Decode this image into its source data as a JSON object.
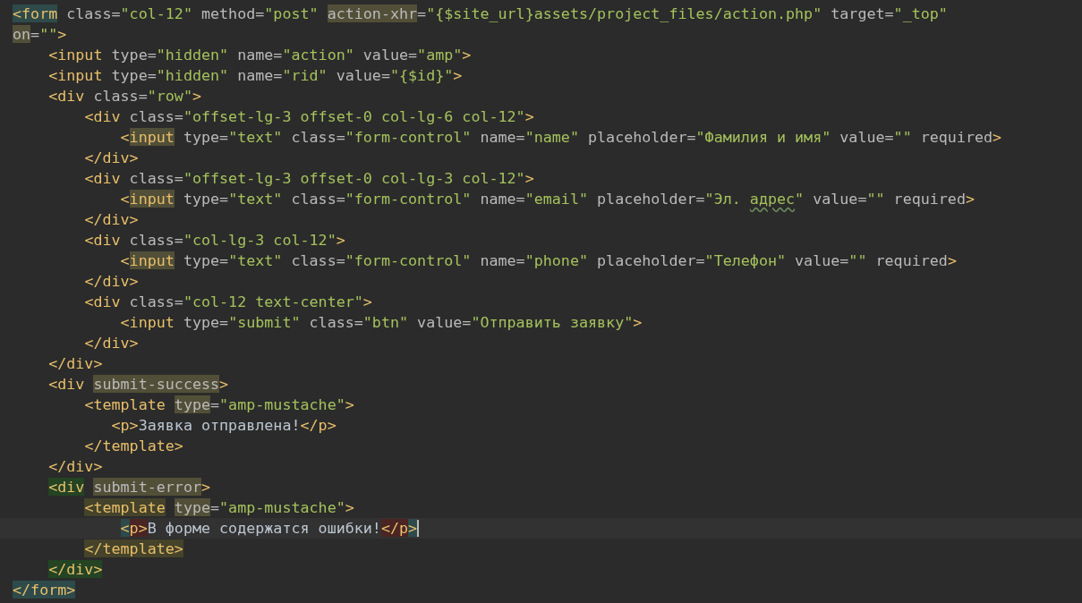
{
  "editor": {
    "lines": [
      {
        "current": false,
        "tokens": [
          {
            "t": "<form",
            "kind": "tag",
            "color": "#2e4a4a"
          },
          {
            "t": " class=",
            "kind": "attr"
          },
          {
            "t": "\"col-12\"",
            "kind": "str"
          },
          {
            "t": " method=",
            "kind": "attr"
          },
          {
            "t": "\"post\"",
            "kind": "str"
          },
          {
            "t": " action-xhr",
            "kind": "attr",
            "color": "#524f38"
          },
          {
            "t": "=",
            "kind": "attr"
          },
          {
            "t": "\"{$site_url}assets/project_files/action.php\"",
            "kind": "str"
          },
          {
            "t": " target=",
            "kind": "attr"
          },
          {
            "t": "\"_top\"",
            "kind": "str"
          }
        ]
      },
      {
        "current": false,
        "tokens": [
          {
            "t": "on",
            "kind": "attr",
            "color": "#524f38"
          },
          {
            "t": "=",
            "kind": "attr"
          },
          {
            "t": "\"\"",
            "kind": "str"
          },
          {
            "t": ">",
            "kind": "tag"
          }
        ]
      },
      {
        "current": false,
        "tokens": [
          {
            "t": "    <input",
            "kind": "tag"
          },
          {
            "t": " type=",
            "kind": "attr"
          },
          {
            "t": "\"hidden\"",
            "kind": "str"
          },
          {
            "t": " name=",
            "kind": "attr"
          },
          {
            "t": "\"action\"",
            "kind": "str"
          },
          {
            "t": " value=",
            "kind": "attr"
          },
          {
            "t": "\"amp\"",
            "kind": "str"
          },
          {
            "t": ">",
            "kind": "tag"
          }
        ]
      },
      {
        "current": false,
        "tokens": [
          {
            "t": "    <input",
            "kind": "tag"
          },
          {
            "t": " type=",
            "kind": "attr"
          },
          {
            "t": "\"hidden\"",
            "kind": "str"
          },
          {
            "t": " name=",
            "kind": "attr"
          },
          {
            "t": "\"rid\"",
            "kind": "str"
          },
          {
            "t": " value=",
            "kind": "attr"
          },
          {
            "t": "\"{$id}\"",
            "kind": "str"
          },
          {
            "t": ">",
            "kind": "tag"
          }
        ]
      },
      {
        "current": false,
        "tokens": [
          {
            "t": "    <div",
            "kind": "tag"
          },
          {
            "t": " class=",
            "kind": "attr"
          },
          {
            "t": "\"row\"",
            "kind": "str"
          },
          {
            "t": ">",
            "kind": "tag"
          }
        ]
      },
      {
        "current": false,
        "tokens": [
          {
            "t": "        <div",
            "kind": "tag"
          },
          {
            "t": " class=",
            "kind": "attr"
          },
          {
            "t": "\"offset-lg-3 offset-0 col-lg-6 col-12\"",
            "kind": "str"
          },
          {
            "t": ">",
            "kind": "tag"
          }
        ]
      },
      {
        "current": false,
        "tokens": [
          {
            "t": "            <",
            "kind": "tag"
          },
          {
            "t": "input",
            "kind": "tag",
            "color": "#524f38"
          },
          {
            "t": " type=",
            "kind": "attr"
          },
          {
            "t": "\"text\"",
            "kind": "str"
          },
          {
            "t": " class=",
            "kind": "attr"
          },
          {
            "t": "\"form-control\"",
            "kind": "str"
          },
          {
            "t": " name=",
            "kind": "attr"
          },
          {
            "t": "\"name\"",
            "kind": "str"
          },
          {
            "t": " placeholder=",
            "kind": "attr"
          },
          {
            "t": "\"Фамилия и имя\"",
            "kind": "str"
          },
          {
            "t": " value=",
            "kind": "attr"
          },
          {
            "t": "\"\"",
            "kind": "str"
          },
          {
            "t": " required",
            "kind": "attr"
          },
          {
            "t": ">",
            "kind": "tag"
          }
        ]
      },
      {
        "current": false,
        "tokens": [
          {
            "t": "        </div>",
            "kind": "tag"
          }
        ]
      },
      {
        "current": false,
        "tokens": [
          {
            "t": "        <div",
            "kind": "tag"
          },
          {
            "t": " class=",
            "kind": "attr"
          },
          {
            "t": "\"offset-lg-3 offset-0 col-lg-3 col-12\"",
            "kind": "str"
          },
          {
            "t": ">",
            "kind": "tag"
          }
        ]
      },
      {
        "current": false,
        "tokens": [
          {
            "t": "            <",
            "kind": "tag"
          },
          {
            "t": "input",
            "kind": "tag",
            "color": "#524f38"
          },
          {
            "t": " type=",
            "kind": "attr"
          },
          {
            "t": "\"text\"",
            "kind": "str"
          },
          {
            "t": " class=",
            "kind": "attr"
          },
          {
            "t": "\"form-control\"",
            "kind": "str"
          },
          {
            "t": " name=",
            "kind": "attr"
          },
          {
            "t": "\"email\"",
            "kind": "str"
          },
          {
            "t": " placeholder=",
            "kind": "attr"
          },
          {
            "t": "\"Эл. ",
            "kind": "str"
          },
          {
            "t": "адрес",
            "kind": "str",
            "misspelled": true
          },
          {
            "t": "\"",
            "kind": "str"
          },
          {
            "t": " value=",
            "kind": "attr"
          },
          {
            "t": "\"\"",
            "kind": "str"
          },
          {
            "t": " required",
            "kind": "attr"
          },
          {
            "t": ">",
            "kind": "tag"
          }
        ]
      },
      {
        "current": false,
        "tokens": [
          {
            "t": "        </div>",
            "kind": "tag"
          }
        ]
      },
      {
        "current": false,
        "tokens": [
          {
            "t": "        <div",
            "kind": "tag"
          },
          {
            "t": " class=",
            "kind": "attr"
          },
          {
            "t": "\"col-lg-3 col-12\"",
            "kind": "str"
          },
          {
            "t": ">",
            "kind": "tag"
          }
        ]
      },
      {
        "current": false,
        "tokens": [
          {
            "t": "            <",
            "kind": "tag"
          },
          {
            "t": "input",
            "kind": "tag",
            "color": "#524f38"
          },
          {
            "t": " type=",
            "kind": "attr"
          },
          {
            "t": "\"text\"",
            "kind": "str"
          },
          {
            "t": " class=",
            "kind": "attr"
          },
          {
            "t": "\"form-control\"",
            "kind": "str"
          },
          {
            "t": " name=",
            "kind": "attr"
          },
          {
            "t": "\"phone\"",
            "kind": "str"
          },
          {
            "t": " placeholder=",
            "kind": "attr"
          },
          {
            "t": "\"Телефон\"",
            "kind": "str"
          },
          {
            "t": " value=",
            "kind": "attr"
          },
          {
            "t": "\"\"",
            "kind": "str"
          },
          {
            "t": " required",
            "kind": "attr"
          },
          {
            "t": ">",
            "kind": "tag"
          }
        ]
      },
      {
        "current": false,
        "tokens": [
          {
            "t": "        </div>",
            "kind": "tag"
          }
        ]
      },
      {
        "current": false,
        "tokens": [
          {
            "t": "        <div",
            "kind": "tag"
          },
          {
            "t": " class=",
            "kind": "attr"
          },
          {
            "t": "\"col-12 text-center\"",
            "kind": "str"
          },
          {
            "t": ">",
            "kind": "tag"
          }
        ]
      },
      {
        "current": false,
        "tokens": [
          {
            "t": "            <input",
            "kind": "tag"
          },
          {
            "t": " type=",
            "kind": "attr"
          },
          {
            "t": "\"submit\"",
            "kind": "str"
          },
          {
            "t": " class=",
            "kind": "attr"
          },
          {
            "t": "\"btn\"",
            "kind": "str"
          },
          {
            "t": " value=",
            "kind": "attr"
          },
          {
            "t": "\"Отправить заявку\"",
            "kind": "str"
          },
          {
            "t": ">",
            "kind": "tag"
          }
        ]
      },
      {
        "current": false,
        "tokens": [
          {
            "t": "        </div>",
            "kind": "tag"
          }
        ]
      },
      {
        "current": false,
        "tokens": [
          {
            "t": "    </div>",
            "kind": "tag"
          }
        ]
      },
      {
        "current": false,
        "tokens": [
          {
            "t": "    <div",
            "kind": "tag"
          },
          {
            "t": " submit-success",
            "kind": "attr",
            "color": "#524f38"
          },
          {
            "t": ">",
            "kind": "tag"
          }
        ]
      },
      {
        "current": false,
        "tokens": [
          {
            "t": "        <template",
            "kind": "tag"
          },
          {
            "t": " type",
            "kind": "attr",
            "color": "#524f38"
          },
          {
            "t": "=",
            "kind": "attr"
          },
          {
            "t": "\"amp-mustache\"",
            "kind": "str"
          },
          {
            "t": ">",
            "kind": "tag"
          }
        ]
      },
      {
        "current": false,
        "tokens": [
          {
            "t": "           <p>",
            "kind": "tag"
          },
          {
            "t": "Заявка отправлена!",
            "kind": "text"
          },
          {
            "t": "</p>",
            "kind": "tag"
          }
        ]
      },
      {
        "current": false,
        "tokens": [
          {
            "t": "        </template>",
            "kind": "tag"
          }
        ]
      },
      {
        "current": false,
        "tokens": [
          {
            "t": "    </div>",
            "kind": "tag"
          }
        ]
      },
      {
        "current": false,
        "tokens": [
          {
            "t": "    <div",
            "kind": "tag",
            "color": "#244424"
          },
          {
            "t": " submit-error",
            "kind": "attr",
            "color": "#524f38"
          },
          {
            "t": ">",
            "kind": "tag"
          }
        ]
      },
      {
        "current": false,
        "tokens": [
          {
            "t": "        <template",
            "kind": "tag",
            "color": "#45432a"
          },
          {
            "t": " type",
            "kind": "attr",
            "color": "#524f38"
          },
          {
            "t": "=",
            "kind": "attr"
          },
          {
            "t": "\"amp-mustache\"",
            "kind": "str"
          },
          {
            "t": ">",
            "kind": "tag"
          }
        ]
      },
      {
        "current": true,
        "tokens": [
          {
            "t": "            <",
            "kind": "tag",
            "color": "#2e4a4a"
          },
          {
            "t": "p>",
            "kind": "tag",
            "color": "#4b2424"
          },
          {
            "t": "В форме содержатся ошибки!",
            "kind": "text"
          },
          {
            "t": "</p",
            "kind": "tag",
            "color": "#4b2424"
          },
          {
            "t": ">",
            "kind": "tag",
            "color": "#2e4a4a"
          }
        ]
      },
      {
        "current": false,
        "tokens": [
          {
            "t": "        </template>",
            "kind": "tag",
            "color": "#45432a"
          }
        ]
      },
      {
        "current": false,
        "tokens": [
          {
            "t": "    </div>",
            "kind": "tag",
            "color": "#244424"
          }
        ]
      },
      {
        "current": false,
        "tokens": [
          {
            "t": "</form>",
            "kind": "tag",
            "color": "#2e4a4a"
          }
        ]
      }
    ]
  }
}
